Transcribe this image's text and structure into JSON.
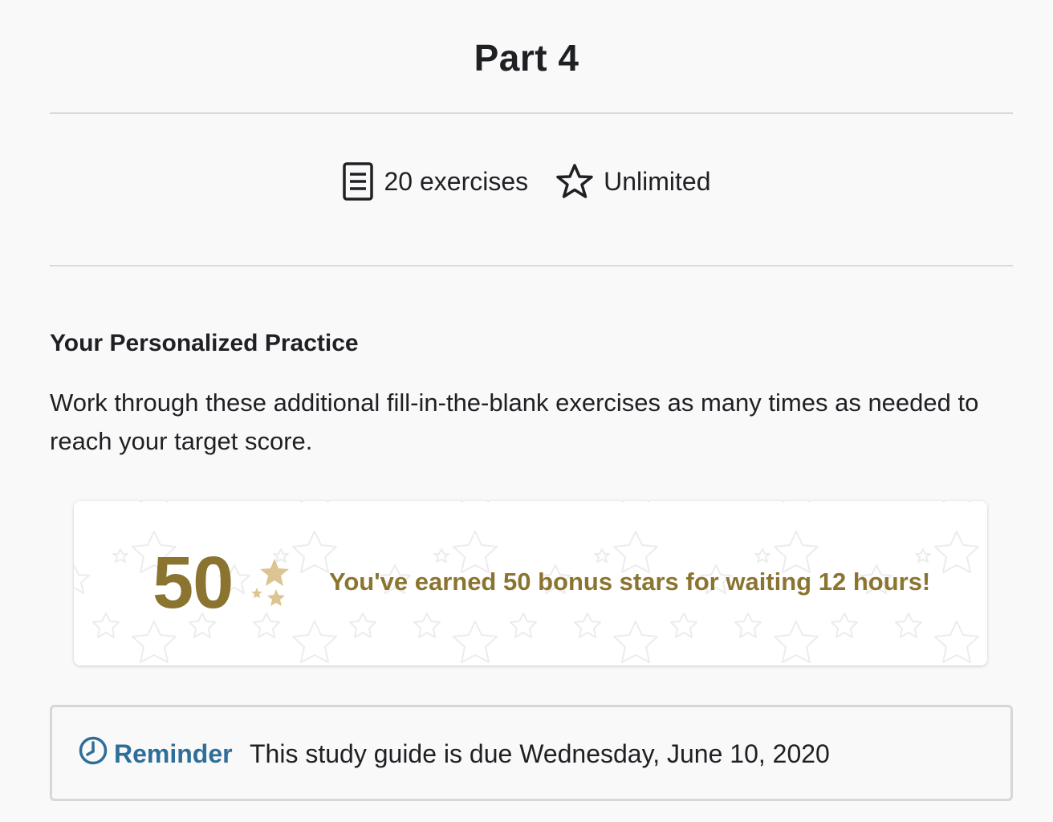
{
  "header": {
    "title": "Part 4"
  },
  "meta": {
    "exercises_label": "20 exercises",
    "attempts_label": "Unlimited",
    "exercises_icon": "document-icon",
    "attempts_icon": "star-outline-icon"
  },
  "practice": {
    "heading": "Your Personalized Practice",
    "description": "Work through these additional fill-in-the-blank exercises as many times as needed to reach your target score."
  },
  "bonus": {
    "number": "50",
    "message": "You've earned 50 bonus stars for waiting 12 hours!",
    "accent_color": "#8b7430",
    "stars_color": "#dcc593",
    "icon": "stars-cluster-icon"
  },
  "reminder": {
    "label": "Reminder",
    "text": "This study guide is due Wednesday, June 10, 2020",
    "accent_color": "#2e6e98",
    "icon": "clock-icon"
  }
}
